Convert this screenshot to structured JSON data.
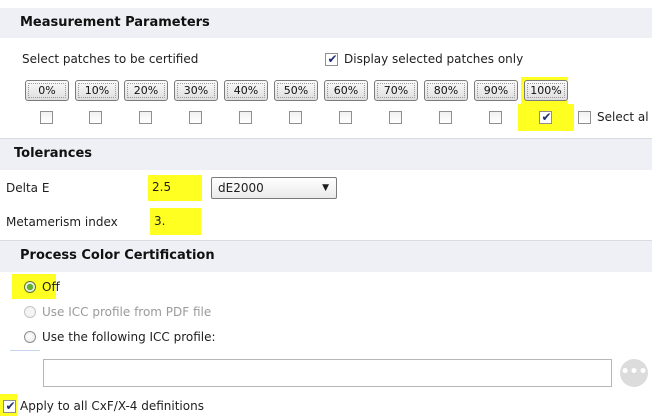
{
  "measurement": {
    "title": "Measurement Parameters",
    "select_label": "Select patches to be certified",
    "display_selected_label": "Display selected patches only",
    "display_selected_checked": true,
    "patches": [
      {
        "label": "0%",
        "checked": false
      },
      {
        "label": "10%",
        "checked": false
      },
      {
        "label": "20%",
        "checked": false
      },
      {
        "label": "30%",
        "checked": false
      },
      {
        "label": "40%",
        "checked": false
      },
      {
        "label": "50%",
        "checked": false
      },
      {
        "label": "60%",
        "checked": false
      },
      {
        "label": "70%",
        "checked": false
      },
      {
        "label": "80%",
        "checked": false
      },
      {
        "label": "90%",
        "checked": false
      },
      {
        "label": "100%",
        "checked": true
      }
    ],
    "select_all_label": "Select al"
  },
  "tolerances": {
    "title": "Tolerances",
    "delta_e_label": "Delta E",
    "delta_e_value": "2.5",
    "delta_e_method": "dE2000",
    "metamerism_label": "Metamerism index",
    "metamerism_value": "3."
  },
  "process": {
    "title": "Process Color Certification",
    "option_off": "Off",
    "option_pdf": "Use ICC profile from PDF file",
    "option_following": "Use the following ICC profile:",
    "selected": "off",
    "profile_path": "",
    "browse_icon": "ellipsis-icon"
  },
  "footer": {
    "apply_all_label": "Apply to all CxF/X-4 definitions",
    "apply_all_checked": true
  },
  "colors": {
    "highlight": "#ffff21",
    "section_bg": "#eef0f5",
    "radio_on": "#5fb02e"
  }
}
